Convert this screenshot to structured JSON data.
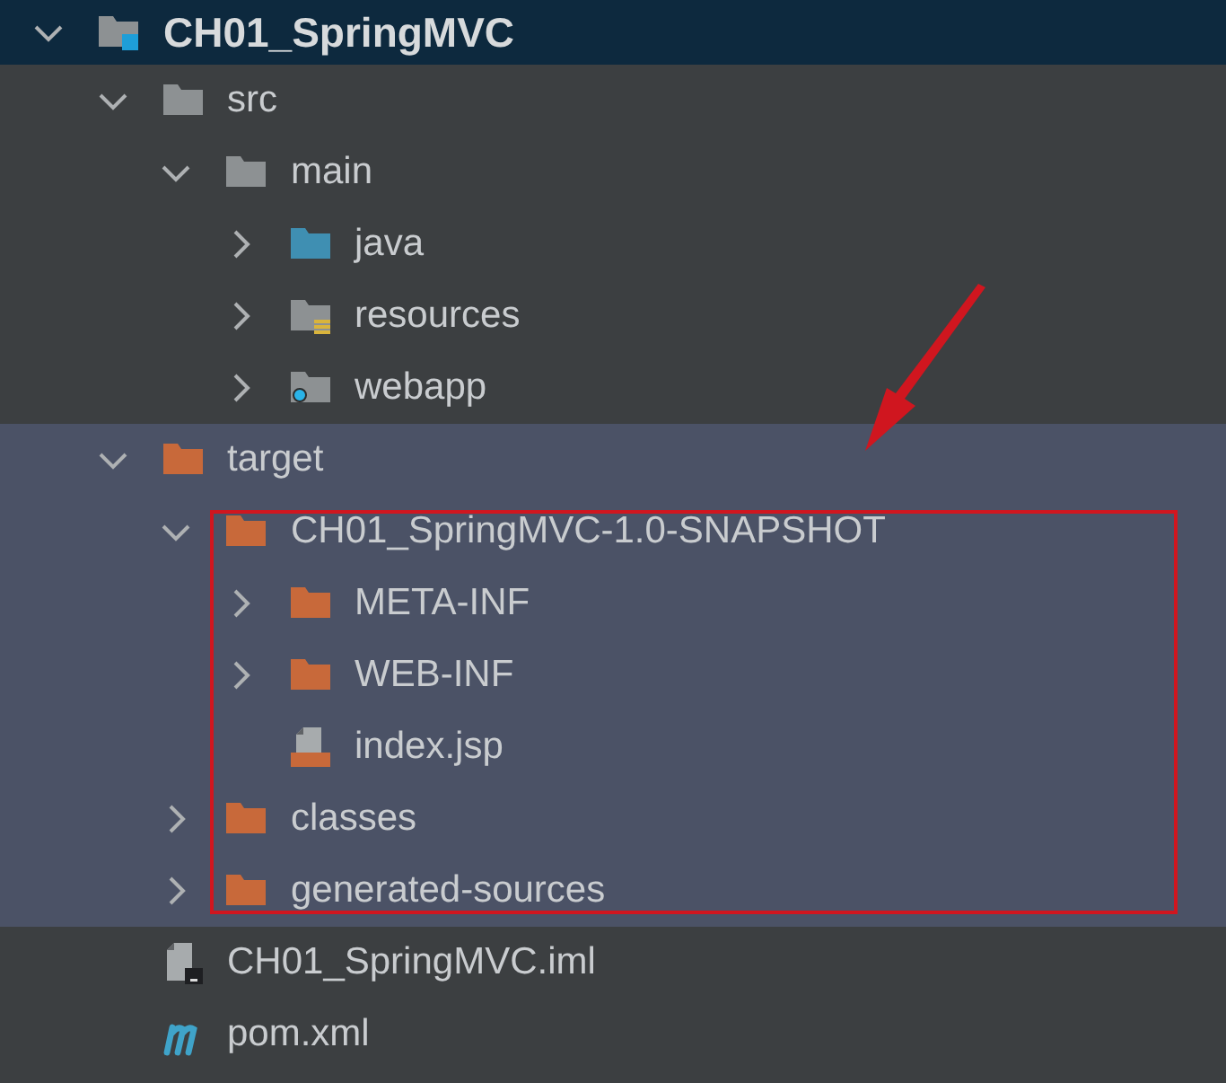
{
  "project_tree": [
    {
      "label": "CH01_SpringMVC",
      "kind": "module",
      "expanded": true,
      "selected": true,
      "highlighted": false,
      "children": [
        {
          "label": "src",
          "kind": "folder",
          "expanded": true,
          "selected": false,
          "highlighted": false,
          "children": [
            {
              "label": "main",
              "kind": "folder",
              "expanded": true,
              "selected": false,
              "highlighted": false,
              "children": [
                {
                  "label": "java",
                  "kind": "source-folder",
                  "expanded": false,
                  "selected": false,
                  "highlighted": false
                },
                {
                  "label": "resources",
                  "kind": "resources-folder",
                  "expanded": false,
                  "selected": false,
                  "highlighted": false
                },
                {
                  "label": "webapp",
                  "kind": "web-folder",
                  "expanded": false,
                  "selected": false,
                  "highlighted": false
                }
              ]
            }
          ]
        },
        {
          "label": "target",
          "kind": "excluded-folder",
          "expanded": true,
          "selected": false,
          "highlighted": true,
          "children": [
            {
              "label": "CH01_SpringMVC-1.0-SNAPSHOT",
              "kind": "excluded-folder",
              "expanded": true,
              "selected": false,
              "highlighted": true,
              "children": [
                {
                  "label": "META-INF",
                  "kind": "excluded-folder",
                  "expanded": false,
                  "selected": false,
                  "highlighted": true
                },
                {
                  "label": "WEB-INF",
                  "kind": "excluded-folder",
                  "expanded": false,
                  "selected": false,
                  "highlighted": true
                },
                {
                  "label": "index.jsp",
                  "kind": "jsp-file",
                  "selected": false,
                  "highlighted": true
                }
              ]
            },
            {
              "label": "classes",
              "kind": "excluded-folder",
              "expanded": false,
              "selected": false,
              "highlighted": true
            },
            {
              "label": "generated-sources",
              "kind": "excluded-folder",
              "expanded": false,
              "selected": false,
              "highlighted": true
            }
          ]
        },
        {
          "label": "CH01_SpringMVC.iml",
          "kind": "iml-file",
          "selected": false,
          "highlighted": false
        },
        {
          "label": "pom.xml",
          "kind": "maven-file",
          "selected": false,
          "highlighted": false
        }
      ]
    }
  ]
}
